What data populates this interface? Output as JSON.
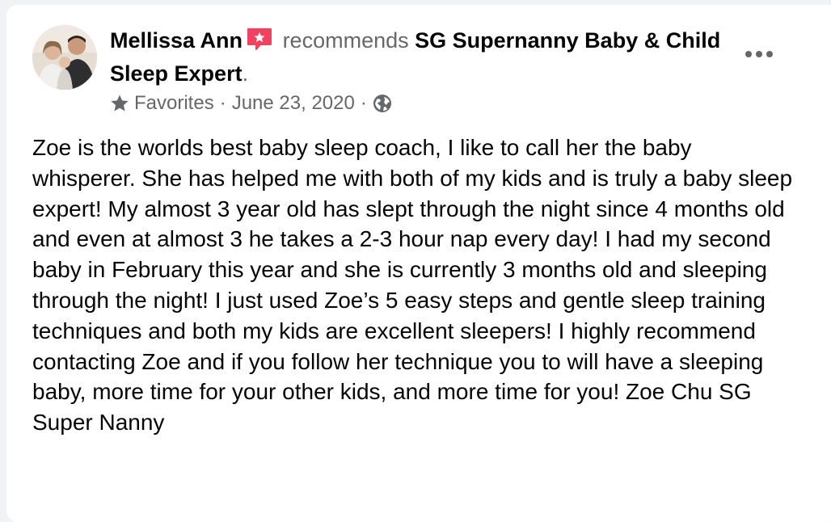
{
  "post": {
    "author": "Mellissa Ann",
    "action": "recommends",
    "page": "SG Supernanny Baby & Child Sleep Expert",
    "period": ".",
    "audience_label": "Favorites",
    "separator": "·",
    "date": "June 23, 2020",
    "body": "Zoe is the worlds best baby sleep coach, I like to call her the baby whisperer. She has helped me with both of my kids and is truly a baby sleep expert! My almost 3 year old has slept through the night since 4 months old and even at almost 3 he takes a 2-3 hour nap every day! I had my second baby in February this year and she is currently 3 months old and sleeping through the night! I just used Zoe’s 5 easy steps and gentle sleep training techniques and both my kids are excellent sleepers! I highly recommend contacting Zoe and if you follow her technique you to will have a sleeping baby, more time for your other kids, and more time for you! Zoe Chu SG Super Nanny"
  },
  "icons": {
    "recommend_badge": "recommend-badge-icon",
    "audience": "star-icon",
    "privacy": "globe-icon",
    "more": "more-options-icon"
  },
  "colors": {
    "card": "#ffffff",
    "background": "#f0f2f5",
    "text_primary": "#050505",
    "text_secondary": "#65676b",
    "recommend_badge": "#f3425f"
  }
}
